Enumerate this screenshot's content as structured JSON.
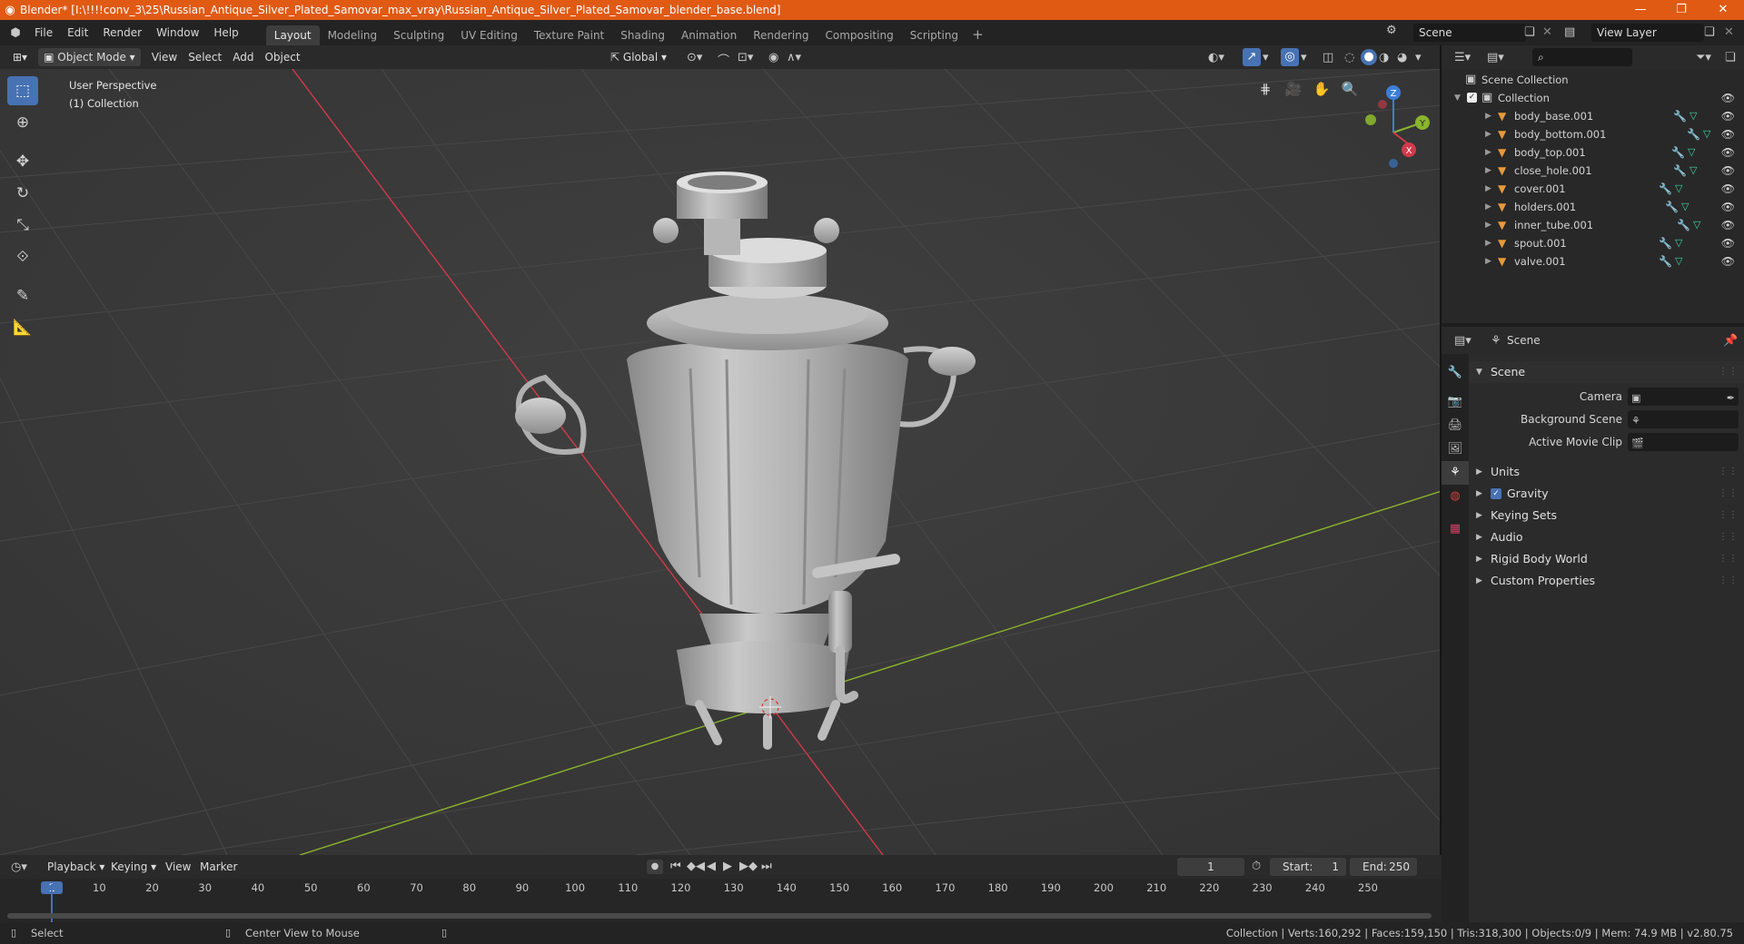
{
  "window": {
    "title": "Blender* [I:\\!!!!conv_3\\25\\Russian_Antique_Silver_Plated_Samovar_max_vray\\Russian_Antique_Silver_Plated_Samovar_blender_base.blend]",
    "minimize": "—",
    "maximize": "❐",
    "close": "✕"
  },
  "menu": [
    "File",
    "Edit",
    "Render",
    "Window",
    "Help"
  ],
  "workspaces": [
    "Layout",
    "Modeling",
    "Sculpting",
    "UV Editing",
    "Texture Paint",
    "Shading",
    "Animation",
    "Rendering",
    "Compositing",
    "Scripting"
  ],
  "active_workspace": "Layout",
  "scene_field": "Scene",
  "view_layer_field": "View Layer",
  "viewport_header": {
    "mode": "Object Mode",
    "menus": [
      "View",
      "Select",
      "Add",
      "Object"
    ],
    "orientation": "Global"
  },
  "viewport": {
    "perspective": "User Perspective",
    "collection": "(1) Collection",
    "gizmo": {
      "x": "X",
      "y": "Y",
      "z": "Z"
    }
  },
  "outliner": {
    "root": "Scene Collection",
    "collection": "Collection",
    "objects": [
      "body_base.001",
      "body_bottom.001",
      "body_top.001",
      "close_hole.001",
      "cover.001",
      "holders.001",
      "inner_tube.001",
      "spout.001",
      "valve.001"
    ]
  },
  "properties": {
    "context": "Scene",
    "panel": "Scene",
    "fields": [
      {
        "label": "Camera"
      },
      {
        "label": "Background Scene"
      },
      {
        "label": "Active Movie Clip"
      }
    ],
    "subpanels": [
      "Units",
      "Gravity",
      "Keying Sets",
      "Audio",
      "Rigid Body World",
      "Custom Properties"
    ],
    "gravity_checked": true
  },
  "timeline": {
    "menus": [
      "Playback",
      "Keying",
      "View",
      "Marker"
    ],
    "current_frame": "1",
    "start_label": "Start:",
    "start": "1",
    "end_label": "End:",
    "end": "250",
    "ruler": [
      "1",
      "10",
      "20",
      "30",
      "40",
      "50",
      "60",
      "70",
      "80",
      "90",
      "100",
      "110",
      "120",
      "130",
      "140",
      "150",
      "160",
      "170",
      "180",
      "190",
      "200",
      "210",
      "220",
      "230",
      "240",
      "250"
    ]
  },
  "status": {
    "left": "Select",
    "middle": "Center View to Mouse",
    "right": "Collection | Verts:160,292 | Faces:159,150 | Tris:318,300 | Objects:0/9 | Mem: 74.9 MB | v2.80.75"
  },
  "colors": {
    "title_bar": "#e05a14",
    "active_tool": "#4772b3",
    "x_axis": "#d13a4a",
    "y_axis": "#8ab52c",
    "z_axis": "#3b7fd9",
    "object_icon": "#e8993a",
    "mesh_icon": "#3fd6a0"
  }
}
